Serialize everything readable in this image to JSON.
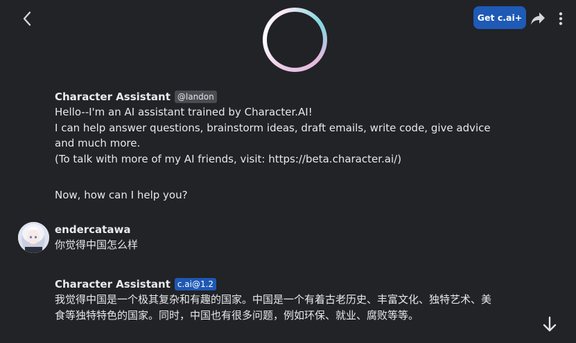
{
  "header": {
    "plus_button_label": "Get c.ai+"
  },
  "messages": [
    {
      "author": "Character Assistant",
      "badge": "@landon",
      "lines": [
        "Hello--I'm an AI assistant trained by Character.AI!",
        "I can help answer questions, brainstorm ideas, draft emails, write code, give advice and much more.",
        "(To talk with more of my AI friends, visit: https://beta.character.ai/)",
        "Now, how can I help you?"
      ]
    },
    {
      "author": "endercatawa",
      "text": "你觉得中国怎么样"
    },
    {
      "author": "Character Assistant",
      "badge": "c.ai@1.2",
      "text": "我觉得中国是一个极其复杂和有趣的国家。中国是一个有着古老历史、丰富文化、独特艺术、美食等独特特色的国家。同时，中国也有很多问题，例如环保、就业、腐败等等。"
    }
  ],
  "colors": {
    "background": "#212327",
    "accent": "#1e5ab6",
    "badge_gray": "#4a4c52"
  },
  "icons": [
    "chevron-left-icon",
    "share-icon",
    "more-vertical-icon",
    "arrow-down-icon"
  ]
}
